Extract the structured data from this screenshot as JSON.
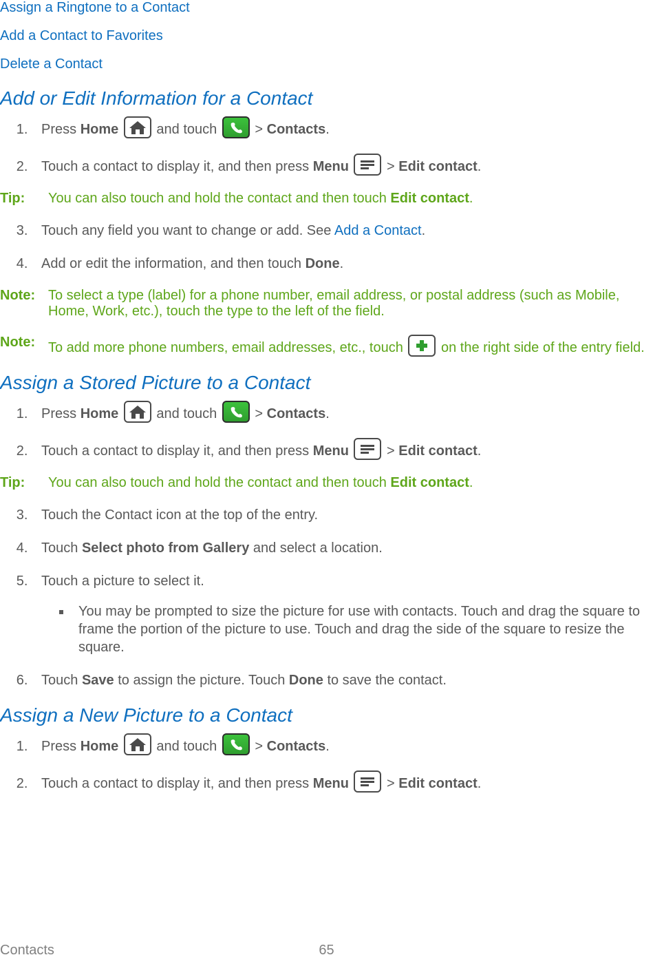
{
  "topLinks": {
    "ringtone": "Assign a Ringtone to a Contact",
    "favorites": "Add a Contact to Favorites",
    "delete": "Delete a Contact"
  },
  "sections": {
    "edit": {
      "heading": "Add or Edit Information for a Contact"
    },
    "stored": {
      "heading": "Assign a Stored Picture to a Contact"
    },
    "newpic": {
      "heading": "Assign a New Picture to a Contact"
    }
  },
  "step": {
    "press": "Press ",
    "home": "Home",
    "andTouch": " and touch ",
    "gt": " > ",
    "contacts": "Contacts",
    "period": ".",
    "touchContact1": "Touch a contact to display it, and then press ",
    "menu": "Menu",
    "editContact": "Edit contact",
    "edit3a": "Touch any field you want to change or add. See ",
    "addAContact": "Add a Contact",
    "edit4a": "Add or edit the information, and then touch ",
    "done": "Done",
    "stored3": "Touch the Contact icon at the top of the entry.",
    "stored4a": "Touch ",
    "stored4b": "Select photo from Gallery",
    "stored4c": " and select a location.",
    "stored5": "Touch a picture to select it.",
    "stored5sub": "You may be prompted to size the picture for use with contacts. Touch and drag the square to frame the portion of the picture to use. Touch and drag the side of the square to resize the square.",
    "stored6a": "Touch ",
    "save": "Save",
    "stored6b": " to assign the picture. Touch ",
    "stored6c": " to save the contact."
  },
  "callouts": {
    "tipLabel": "Tip:",
    "noteLabel": "Note:",
    "tip1a": "You can also touch and hold the contact and then touch ",
    "tip1b": "Edit contact",
    "tip1c": ".",
    "note1": "To select a type (label) for a phone number, email address, or postal address (such as Mobile, Home, Work, etc.), touch the type to the left of the field.",
    "note2a": "To add more phone numbers, email addresses, etc., touch ",
    "note2b": " on the right side of the entry field."
  },
  "footer": {
    "title": "Contacts",
    "page": "65"
  }
}
